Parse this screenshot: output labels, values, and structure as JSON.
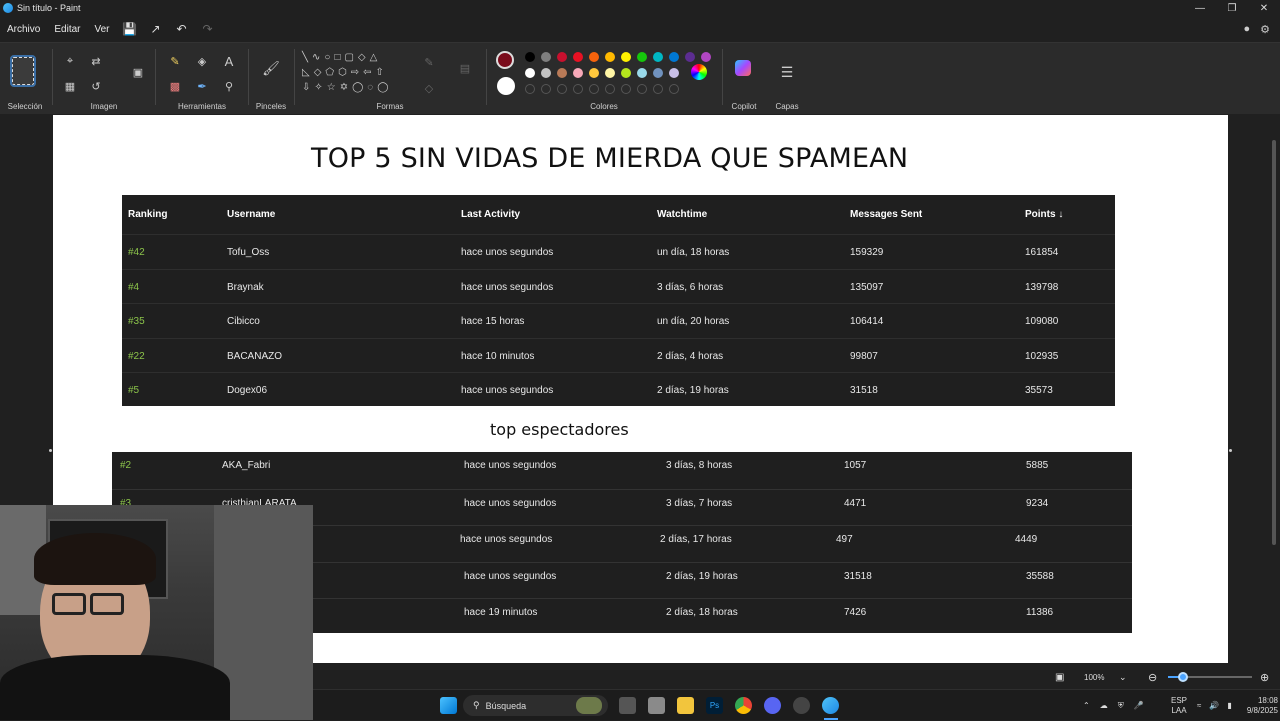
{
  "window": {
    "title": "Sin título - Paint"
  },
  "menu": {
    "archivo": "Archivo",
    "editar": "Editar",
    "ver": "Ver"
  },
  "ribbon": {
    "seleccion": "Selección",
    "imagen": "Imagen",
    "herramientas": "Herramientas",
    "pinceles": "Pinceles",
    "formas": "Formas",
    "colores": "Colores",
    "copilot": "Copilot",
    "capas": "Capas"
  },
  "colors": {
    "primary": "#7a0c1c",
    "secondary": "#ffffff",
    "row1": [
      "#000000",
      "#7f7f7f",
      "#c8102e",
      "#e81123",
      "#f7630c",
      "#ffb900",
      "#fff100",
      "#16c60c",
      "#00b7c3",
      "#0078d4",
      "#5c2d91",
      "#b146c2"
    ],
    "row2": [
      "#ffffff",
      "#c3c3c3",
      "#b97a57",
      "#f7a8b8",
      "#ffc83d",
      "#fff5a5",
      "#b5e61d",
      "#99d9ea",
      "#7092be",
      "#c8bfe7"
    ]
  },
  "canvas": {
    "heading": "TOP 5 SIN VIDAS DE MIERDA QUE SPAMEAN",
    "table1": {
      "headers": [
        "Ranking",
        "Username",
        "Last Activity",
        "Watchtime",
        "Messages Sent",
        "Points ↓"
      ],
      "rows": [
        [
          "#42",
          "Tofu_Oss",
          "hace unos segundos",
          "un día, 18 horas",
          "159329",
          "161854"
        ],
        [
          "#4",
          "Braynak",
          "hace unos segundos",
          "3 días, 6 horas",
          "135097",
          "139798"
        ],
        [
          "#35",
          "Cibicco",
          "hace 15 horas",
          "un día, 20 horas",
          "106414",
          "109080"
        ],
        [
          "#22",
          "BACANAZO",
          "hace 10 minutos",
          "2 días, 4 horas",
          "99807",
          "102935"
        ],
        [
          "#5",
          "Dogex06",
          "hace unos segundos",
          "2 días, 19 horas",
          "31518",
          "35573"
        ]
      ]
    },
    "subheading": "top espectadores",
    "table2": {
      "rows": [
        [
          "#2",
          "AKA_Fabri",
          "hace unos segundos",
          "3 días, 8 horas",
          "1057",
          "5885"
        ],
        [
          "#3",
          "cristhianLARATA",
          "hace unos segundos",
          "3 días, 7 horas",
          "4471",
          "9234"
        ],
        [
          "",
          "",
          "hace unos segundos",
          "2 días, 17 horas",
          "497",
          "4449"
        ],
        [
          "",
          "",
          "hace unos segundos",
          "2 días, 19 horas",
          "31518",
          "35588"
        ],
        [
          "",
          "",
          "hace 19 minutos",
          "2 días, 18 horas",
          "7426",
          "11386"
        ]
      ]
    }
  },
  "status": {
    "zoom": "100%"
  },
  "taskbar": {
    "search_placeholder": "Búsqueda",
    "lang": "ESP",
    "lang2": "LAA",
    "time": "18:08",
    "date": "9/8/2025"
  }
}
